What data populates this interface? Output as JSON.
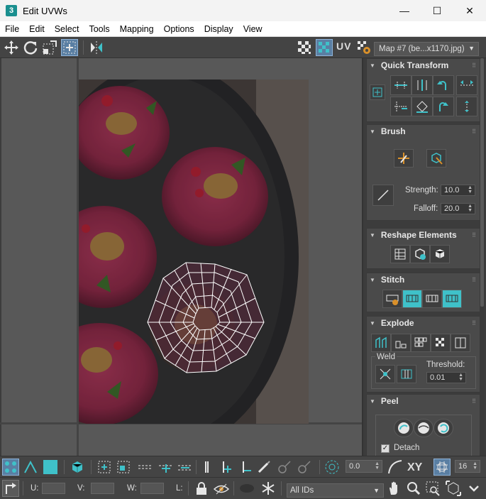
{
  "window": {
    "app_badge": "3",
    "title": "Edit UVWs",
    "minimize": "—",
    "maximize": "☐",
    "close": "✕"
  },
  "menu": [
    "File",
    "Edit",
    "Select",
    "Tools",
    "Mapping",
    "Options",
    "Display",
    "View"
  ],
  "toolbar_top": {
    "uv_label": "UV",
    "map_selector": "Map #7 (be...x1170.jpg)"
  },
  "panel": {
    "quick_transform": {
      "title": "Quick Transform"
    },
    "brush": {
      "title": "Brush",
      "strength_label": "Strength:",
      "strength_value": "10.0",
      "falloff_label": "Falloff:",
      "falloff_value": "20.0"
    },
    "reshape": {
      "title": "Reshape Elements"
    },
    "stitch": {
      "title": "Stitch"
    },
    "explode": {
      "title": "Explode",
      "weld_label": "Weld",
      "threshold_label": "Threshold:",
      "threshold_value": "0.01"
    },
    "peel": {
      "title": "Peel",
      "detach_label": "Detach",
      "detach_checked": true
    }
  },
  "bottom_toolbar": {
    "rotate_value": "0.0",
    "xy_label": "XY",
    "grid_value": "16",
    "u_label": "U:",
    "v_label": "V:",
    "w_label": "W:",
    "l_label": "L:",
    "ids_dropdown": "All IDs"
  },
  "colors": {
    "accent": "#3fc1c9",
    "highlight_button": "#5a7fa3",
    "background": "#444444"
  }
}
